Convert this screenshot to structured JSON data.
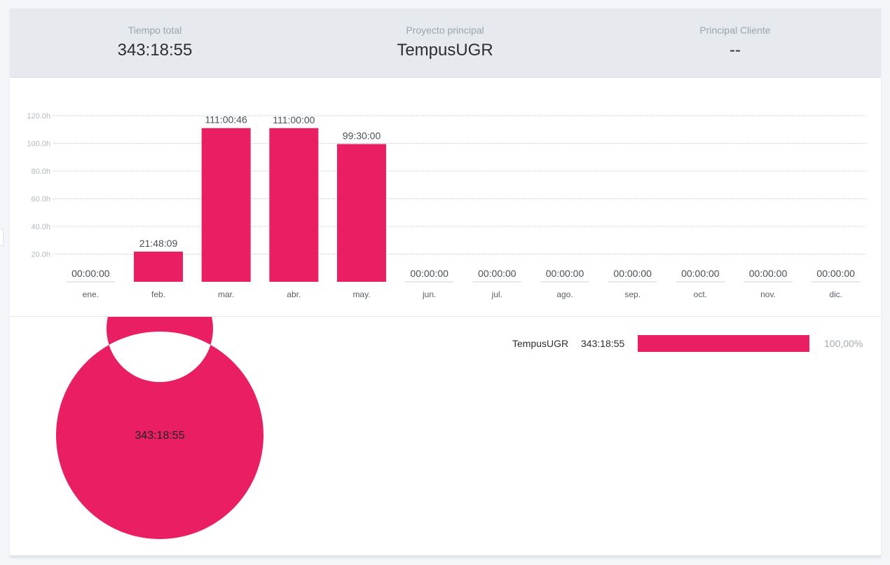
{
  "summary": {
    "total_time": {
      "label": "Tiempo total",
      "value": "343:18:55"
    },
    "main_project": {
      "label": "Proyecto principal",
      "value": "TempusUGR"
    },
    "main_client": {
      "label": "Principal Cliente",
      "value": "--"
    }
  },
  "chart_data": [
    {
      "type": "bar",
      "categories": [
        "ene.",
        "feb.",
        "mar.",
        "abr.",
        "may.",
        "jun.",
        "jul.",
        "ago.",
        "sep.",
        "oct.",
        "nov.",
        "dic."
      ],
      "values": [
        0,
        21.8025,
        111.0128,
        111.0,
        99.5,
        0,
        0,
        0,
        0,
        0,
        0,
        0
      ],
      "data_labels": [
        "00:00:00",
        "21:48:09",
        "111:00:46",
        "111:00:00",
        "99:30:00",
        "00:00:00",
        "00:00:00",
        "00:00:00",
        "00:00:00",
        "00:00:00",
        "00:00:00",
        "00:00:00"
      ],
      "ylim": [
        0,
        120
      ],
      "yticks": [
        "20.0h",
        "40.0h",
        "60.0h",
        "80.0h",
        "100.0h",
        "120.0h"
      ],
      "color": "#ea1e63",
      "grid": true
    },
    {
      "type": "pie",
      "donut": true,
      "center_label": "343:18:55",
      "slices": [
        {
          "name": "TempusUGR",
          "value": 100
        }
      ],
      "color": "#ea1e63"
    }
  ],
  "legend": [
    {
      "name": "TempusUGR",
      "time": "343:18:55",
      "percent_text": "100,00%",
      "fraction": 1.0,
      "color": "#ea1e63"
    }
  ]
}
